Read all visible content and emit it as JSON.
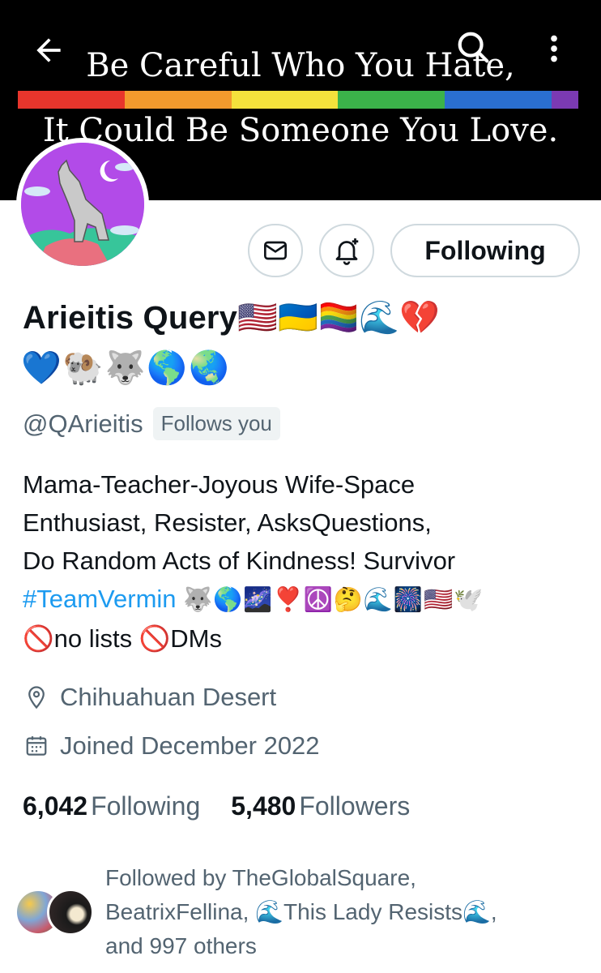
{
  "banner": {
    "line1": "Be Careful Who You Hate,",
    "line2": "It Could Be Someone You Love.",
    "rainbow_colors": [
      "#e8352c",
      "#f39a2d",
      "#f4e23c",
      "#3bb34a",
      "#2a6fd0",
      "#7b3ab3"
    ]
  },
  "nav": {
    "back_icon": "arrow-left-icon",
    "search_icon": "search-icon",
    "more_icon": "more-vertical-icon"
  },
  "profile": {
    "name_text": "Arieitis Query",
    "name_emojis": "🇺🇸🇺🇦🏳️‍🌈🌊💔",
    "name_emojis_line2": "💙🐏🐺🌎🌏",
    "handle": "@QArieitis",
    "follows_you": "Follows you"
  },
  "actions": {
    "message_icon": "mail-icon",
    "notify_icon": "bell-plus-icon",
    "following_label": "Following"
  },
  "bio": {
    "line1": "Mama-Teacher-Joyous Wife-Space",
    "line2": "Enthusiast, Resister, AsksQuestions,",
    "line3": "Do Random Acts of Kindness! Survivor",
    "hashtag": "#TeamVermin",
    "line4_emojis": "🐺🌎🌌❣️☮️🤔🌊🎆🇺🇸🕊️",
    "line5": "🚫no lists 🚫DMs"
  },
  "meta": {
    "location": "Chihuahuan Desert",
    "joined": "Joined December 2022"
  },
  "stats": {
    "following_count": "6,042",
    "following_label": "Following",
    "followers_count": "5,480",
    "followers_label": "Followers"
  },
  "followed_by": {
    "line1": "Followed by TheGlobalSquare,",
    "line2": "BeatrixFellina, 🌊This Lady Resists🌊,",
    "line3": "and 997 others"
  },
  "colors": {
    "accent": "#1d9bf0",
    "secondary_text": "#536471",
    "primary_text": "#0f1419",
    "button_border": "#cfd9de"
  }
}
